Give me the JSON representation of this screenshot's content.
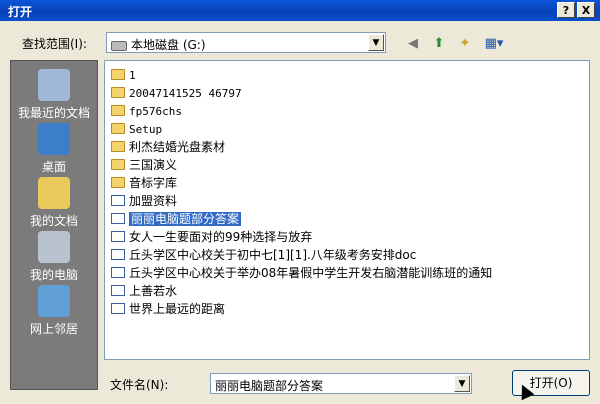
{
  "window": {
    "title": "打开",
    "help": "?",
    "close": "X"
  },
  "lookin": {
    "label": "查找范围(I):",
    "value": "本地磁盘 (G:)"
  },
  "places": [
    "我最近的文档",
    "桌面",
    "我的文档",
    "我的电脑",
    "网上邻居"
  ],
  "files": [
    {
      "name": "1",
      "type": "folder"
    },
    {
      "name": "20047141525 46797",
      "type": "folder"
    },
    {
      "name": "fp576chs",
      "type": "folder"
    },
    {
      "name": "Setup",
      "type": "folder"
    },
    {
      "name": "利杰结婚光盘素材",
      "type": "folder"
    },
    {
      "name": "三国演义",
      "type": "folder"
    },
    {
      "name": "音标字库",
      "type": "folder"
    },
    {
      "name": "加盟资料",
      "type": "doc"
    },
    {
      "name": "丽丽电脑题部分答案",
      "type": "doc",
      "selected": true
    },
    {
      "name": "女人一生要面对的99种选择与放弃",
      "type": "doc"
    },
    {
      "name": "丘头学区中心校关于初中七[1][1].八年级考务安排doc",
      "type": "doc"
    },
    {
      "name": "丘头学区中心校关于举办08年暑假中学生开发右脑潜能训练班的通知",
      "type": "doc"
    },
    {
      "name": "上善若水",
      "type": "doc"
    },
    {
      "name": "世界上最远的距离",
      "type": "doc"
    }
  ],
  "filename": {
    "label": "文件名(N):",
    "value": "丽丽电脑题部分答案"
  },
  "open_button": "打开(O)",
  "colors": {
    "title_bar": "#0a4fcf",
    "selection": "#316ac5",
    "places_bg": "#7b7b7b"
  }
}
